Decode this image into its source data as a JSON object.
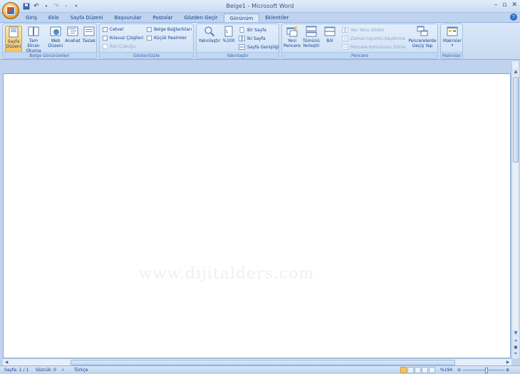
{
  "window": {
    "title": "Belge1 - Microsoft Word",
    "controls": [
      "–",
      "▫",
      "✕"
    ]
  },
  "quick_access": [
    "save-icon",
    "undo-icon",
    "redo-icon",
    "customize-icon"
  ],
  "tabs": [
    {
      "label": "Giriş",
      "active": false
    },
    {
      "label": "Ekle",
      "active": false
    },
    {
      "label": "Sayfa Düzeni",
      "active": false
    },
    {
      "label": "Başvurular",
      "active": false
    },
    {
      "label": "Postalar",
      "active": false
    },
    {
      "label": "Gözden Geçir",
      "active": false
    },
    {
      "label": "Görünüm",
      "active": true
    },
    {
      "label": "Eklentiler",
      "active": false
    }
  ],
  "ribbon": {
    "belge_gorunumleri": {
      "label": "Belge Görünümleri",
      "sayfa_duzeni": "Sayfa Düzeni",
      "tam_ekran": "Tam Ekran Okuma",
      "web_duzeni": "Web Düzeni",
      "anahat": "Anahat",
      "taslak": "Taslak"
    },
    "goster_gizle": {
      "label": "Göster/Gizle",
      "cetvel": "Cetvel",
      "kilavuz": "Kılavuz Çizgileri",
      "ileti": "İleti Çubuğu",
      "belge_baglantilari": "Belge Bağlantıları",
      "kucuk_resimler": "Küçük Resimler"
    },
    "yakinlastir": {
      "label": "Yakınlaştır",
      "yakinlastir": "Yakınlaştır",
      "yuzde100": "%100",
      "bir_sayfa": "Bir Sayfa",
      "iki_sayfa": "İki Sayfa",
      "sayfa_genisligi": "Sayfa Genişliği"
    },
    "pencere": {
      "label": "Pencere",
      "yeni_pencere": "Yeni Pencere",
      "tumunu_yerlestir": "Tümünü Yerleştir",
      "bol": "Böl",
      "yan_yana": "Yan Yana Göster",
      "zaman_uyumlu": "Zaman Uyumlu Kaydırma",
      "konum_sifirla": "Pencere Konumunu Sıfırla",
      "gecis_yap": "Pencerelerde Geçiş Yap"
    },
    "makrolar": {
      "label": "Makrolar",
      "makrolar": "Makrolar"
    }
  },
  "document": {
    "watermark": "www.dijitalders.com"
  },
  "status": {
    "sayfa": "Sayfa: 1 / 1",
    "sozcuk": "Sözcük: 0",
    "dil": "Türkçe",
    "zoom": "%194"
  }
}
